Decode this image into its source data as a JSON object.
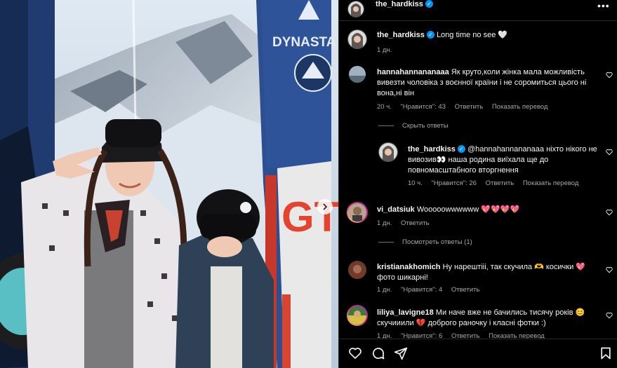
{
  "post": {
    "username": "the_hardkiss",
    "caption_user": "the_hardkiss",
    "caption_text": "Long time no see 🤍",
    "caption_time": "1 дн.",
    "photo_sign_text": "DYNASTA",
    "photo_sign_letters": "GT"
  },
  "comments": [
    {
      "user": "hannahannananaaa",
      "text": "Як круто,коли жінка мала можливість вивезти чоловіка з воєнної країни і не соромиться цього ні вона,ні він",
      "time": "20 ч.",
      "likes": "\"Нравится\": 43",
      "reply": "Ответить",
      "translate": "Показать перевод",
      "toggle": "Скрыть ответы",
      "replies": [
        {
          "user": "the_hardkiss",
          "mention": "@hannahannananaaa",
          "text": "ніхто нікого не вивозив👀 наша родина виїхала ще до повномасштабного вторгнення",
          "time": "10 ч.",
          "likes": "\"Нравится\": 26",
          "reply": "Ответить",
          "translate": "Показать перевод"
        }
      ]
    },
    {
      "user": "vi_datsiuk",
      "text": "Wooooowwwwww 💖💖💖💖",
      "time": "1 дн.",
      "reply": "Ответить",
      "toggle": "Посмотреть ответы (1)"
    },
    {
      "user": "kristianakhomich",
      "text": "Ну нарештііі, так скучила 🫶 косички 💖 фото шикарні!",
      "time": "1 дн.",
      "likes": "\"Нравится\": 4",
      "reply": "Ответить"
    },
    {
      "user": "liliya_lavigne18",
      "text": "Ми наче вже не бачились тисячу років 😊 скучииили 💔 доброго раночку і класні фотки :)",
      "time": "1 дн.",
      "likes": "\"Нравится\": 6",
      "reply": "Ответить",
      "translate": "Показать перевод"
    }
  ],
  "icons": {
    "like": "heart-icon",
    "comment": "comment-icon",
    "share": "share-icon",
    "save": "bookmark-icon",
    "more": "more-icon",
    "verified": "verified-badge-icon",
    "next": "chevron-right-icon"
  },
  "colors": {
    "background": "#000000",
    "text": "#f5f5f5",
    "secondary": "#a8a8a8",
    "verified": "#0095f6",
    "separator": "#262626"
  }
}
